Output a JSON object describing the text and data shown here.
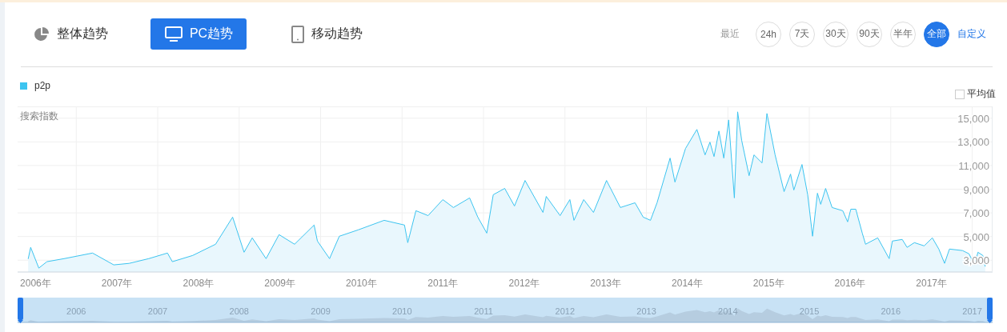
{
  "tabs": [
    {
      "label": "整体趋势",
      "selected": false
    },
    {
      "label": "PC趋势",
      "selected": true
    },
    {
      "label": "移动趋势",
      "selected": false
    }
  ],
  "range": {
    "label": "最近",
    "options": [
      {
        "label": "24h",
        "selected": false
      },
      {
        "label": "7天",
        "selected": false
      },
      {
        "label": "30天",
        "selected": false
      },
      {
        "label": "90天",
        "selected": false
      },
      {
        "label": "半年",
        "selected": false
      },
      {
        "label": "全部",
        "selected": true
      }
    ],
    "custom_link": "自定义"
  },
  "average_toggle": {
    "label": "平均值",
    "checked": false
  },
  "chart_data": {
    "type": "area",
    "grid": true,
    "ylabel": "搜索指数",
    "xlim": [
      2005.78,
      2017.75
    ],
    "ylim": [
      2000,
      16000
    ],
    "yticks": [
      {
        "value": 3000,
        "label": "3,000"
      },
      {
        "value": 5000,
        "label": "5,000"
      },
      {
        "value": 7000,
        "label": "7,000"
      },
      {
        "value": 9000,
        "label": "9,000"
      },
      {
        "value": 11000,
        "label": "11,000"
      },
      {
        "value": 13000,
        "label": "13,000"
      },
      {
        "value": 15000,
        "label": "15,000"
      }
    ],
    "xticks": [
      {
        "value": 2006,
        "label": "2006年"
      },
      {
        "value": 2007,
        "label": "2007年"
      },
      {
        "value": 2008,
        "label": "2008年"
      },
      {
        "value": 2009,
        "label": "2009年"
      },
      {
        "value": 2010,
        "label": "2010年"
      },
      {
        "value": 2011,
        "label": "2011年"
      },
      {
        "value": 2012,
        "label": "2012年"
      },
      {
        "value": 2013,
        "label": "2013年"
      },
      {
        "value": 2014,
        "label": "2014年"
      },
      {
        "value": 2015,
        "label": "2015年"
      },
      {
        "value": 2016,
        "label": "2016年"
      },
      {
        "value": 2017,
        "label": "2017年"
      }
    ],
    "x": [
      2005.91,
      2005.94,
      2006.04,
      2006.14,
      2006.35,
      2006.7,
      2006.96,
      2007.15,
      2007.39,
      2007.62,
      2007.68,
      2007.93,
      2008.21,
      2008.42,
      2008.56,
      2008.66,
      2008.83,
      2008.99,
      2009.18,
      2009.42,
      2009.46,
      2009.61,
      2009.73,
      2009.96,
      2010.28,
      2010.53,
      2010.57,
      2010.67,
      2010.82,
      2011.0,
      2011.13,
      2011.33,
      2011.43,
      2011.54,
      2011.62,
      2011.76,
      2011.88,
      2012.01,
      2012.23,
      2012.27,
      2012.44,
      2012.56,
      2012.61,
      2012.73,
      2012.85,
      2013.01,
      2013.18,
      2013.36,
      2013.46,
      2013.55,
      2013.63,
      2013.79,
      2013.85,
      2013.98,
      2014.12,
      2014.22,
      2014.28,
      2014.33,
      2014.39,
      2014.45,
      2014.51,
      2014.58,
      2014.62,
      2014.67,
      2014.76,
      2014.82,
      2014.92,
      2014.98,
      2015.08,
      2015.19,
      2015.27,
      2015.31,
      2015.41,
      2015.48,
      2015.54,
      2015.6,
      2015.64,
      2015.7,
      2015.78,
      2015.91,
      2015.97,
      2016.01,
      2016.07,
      2016.15,
      2016.19,
      2016.34,
      2016.48,
      2016.52,
      2016.64,
      2016.7,
      2016.79,
      2016.91,
      2017.01,
      2017.09,
      2017.16,
      2017.22,
      2017.38,
      2017.46,
      2017.53,
      2017.57,
      2017.63,
      2017.66
    ],
    "series": [
      {
        "name": "p2p",
        "color": "#3cc4f0",
        "values": [
          3100,
          4080,
          2330,
          2870,
          3130,
          3600,
          2600,
          2730,
          3130,
          3600,
          2870,
          3400,
          4350,
          6640,
          3670,
          4890,
          3130,
          5160,
          4350,
          5970,
          4620,
          3130,
          5020,
          5560,
          6370,
          5970,
          4480,
          7180,
          6770,
          8120,
          7450,
          8260,
          6640,
          5290,
          8530,
          9070,
          7580,
          9740,
          7040,
          8390,
          6770,
          8120,
          6370,
          8120,
          7040,
          9740,
          7450,
          7850,
          6640,
          6370,
          7850,
          11630,
          9600,
          12440,
          14050,
          11900,
          12980,
          11760,
          13920,
          11630,
          14860,
          8260,
          15540,
          13110,
          10140,
          11900,
          11220,
          15400,
          11900,
          8800,
          10280,
          8930,
          11090,
          8530,
          5020,
          8660,
          7720,
          9070,
          7450,
          7180,
          6240,
          7310,
          7310,
          5290,
          4350,
          4890,
          3130,
          4620,
          4750,
          4080,
          4480,
          4210,
          4890,
          3940,
          2730,
          3940,
          3810,
          3540,
          2600,
          3670,
          3400,
          2460
        ]
      }
    ]
  },
  "slider": {
    "labels": [
      "2006",
      "2007",
      "2008",
      "2009",
      "2010",
      "2011",
      "2012",
      "2013",
      "2014",
      "2015",
      "2016",
      "2017"
    ]
  }
}
